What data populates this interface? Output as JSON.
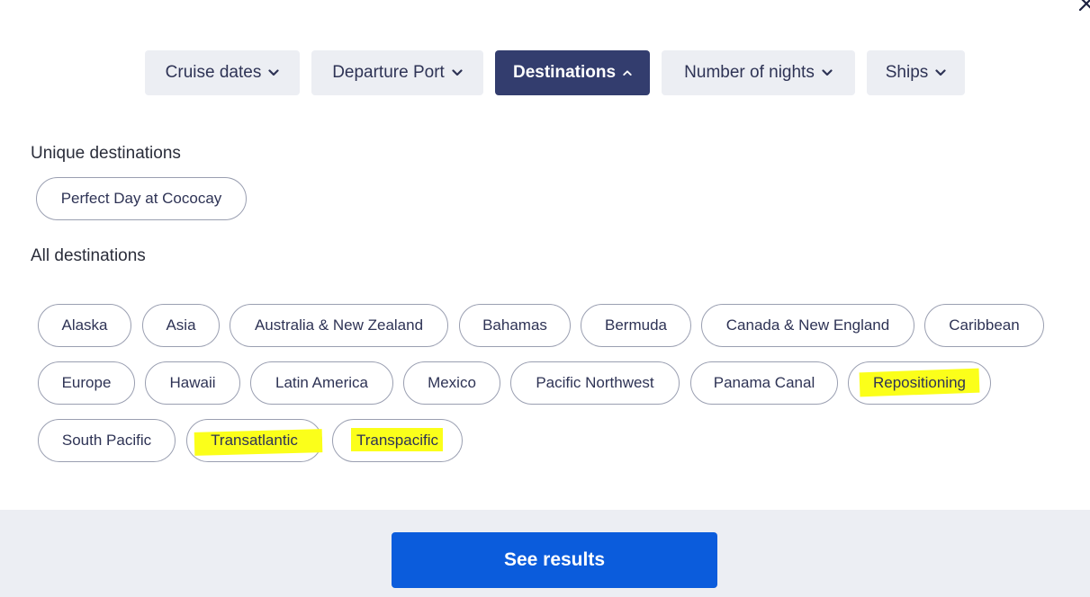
{
  "filters": {
    "cruise_dates": "Cruise dates",
    "departure_port": "Departure Port",
    "destinations": "Destinations",
    "number_of_nights": "Number of nights",
    "ships": "Ships",
    "active": "Destinations"
  },
  "sections": {
    "unique_label": "Unique destinations",
    "all_label": "All destinations"
  },
  "unique_destinations": [
    "Perfect Day at Cococay"
  ],
  "all_destinations": [
    "Alaska",
    "Asia",
    "Australia & New Zealand",
    "Bahamas",
    "Bermuda",
    "Canada & New England",
    "Caribbean",
    "Europe",
    "Hawaii",
    "Latin America",
    "Mexico",
    "Pacific Northwest",
    "Panama Canal",
    "Repositioning",
    "South Pacific",
    "Transatlantic",
    "Transpacific"
  ],
  "highlighted": [
    "Repositioning",
    "Transatlantic",
    "Transpacific"
  ],
  "colors": {
    "active_tab": "#333d6e",
    "tab_bg": "#eceef3",
    "primary_button": "#0b5cdc",
    "highlight": "#fbff1a"
  },
  "footer": {
    "see_results": "See results"
  },
  "icons": {
    "close": "close-icon",
    "chevron_down": "chevron-down-icon",
    "chevron_up": "chevron-up-icon"
  }
}
